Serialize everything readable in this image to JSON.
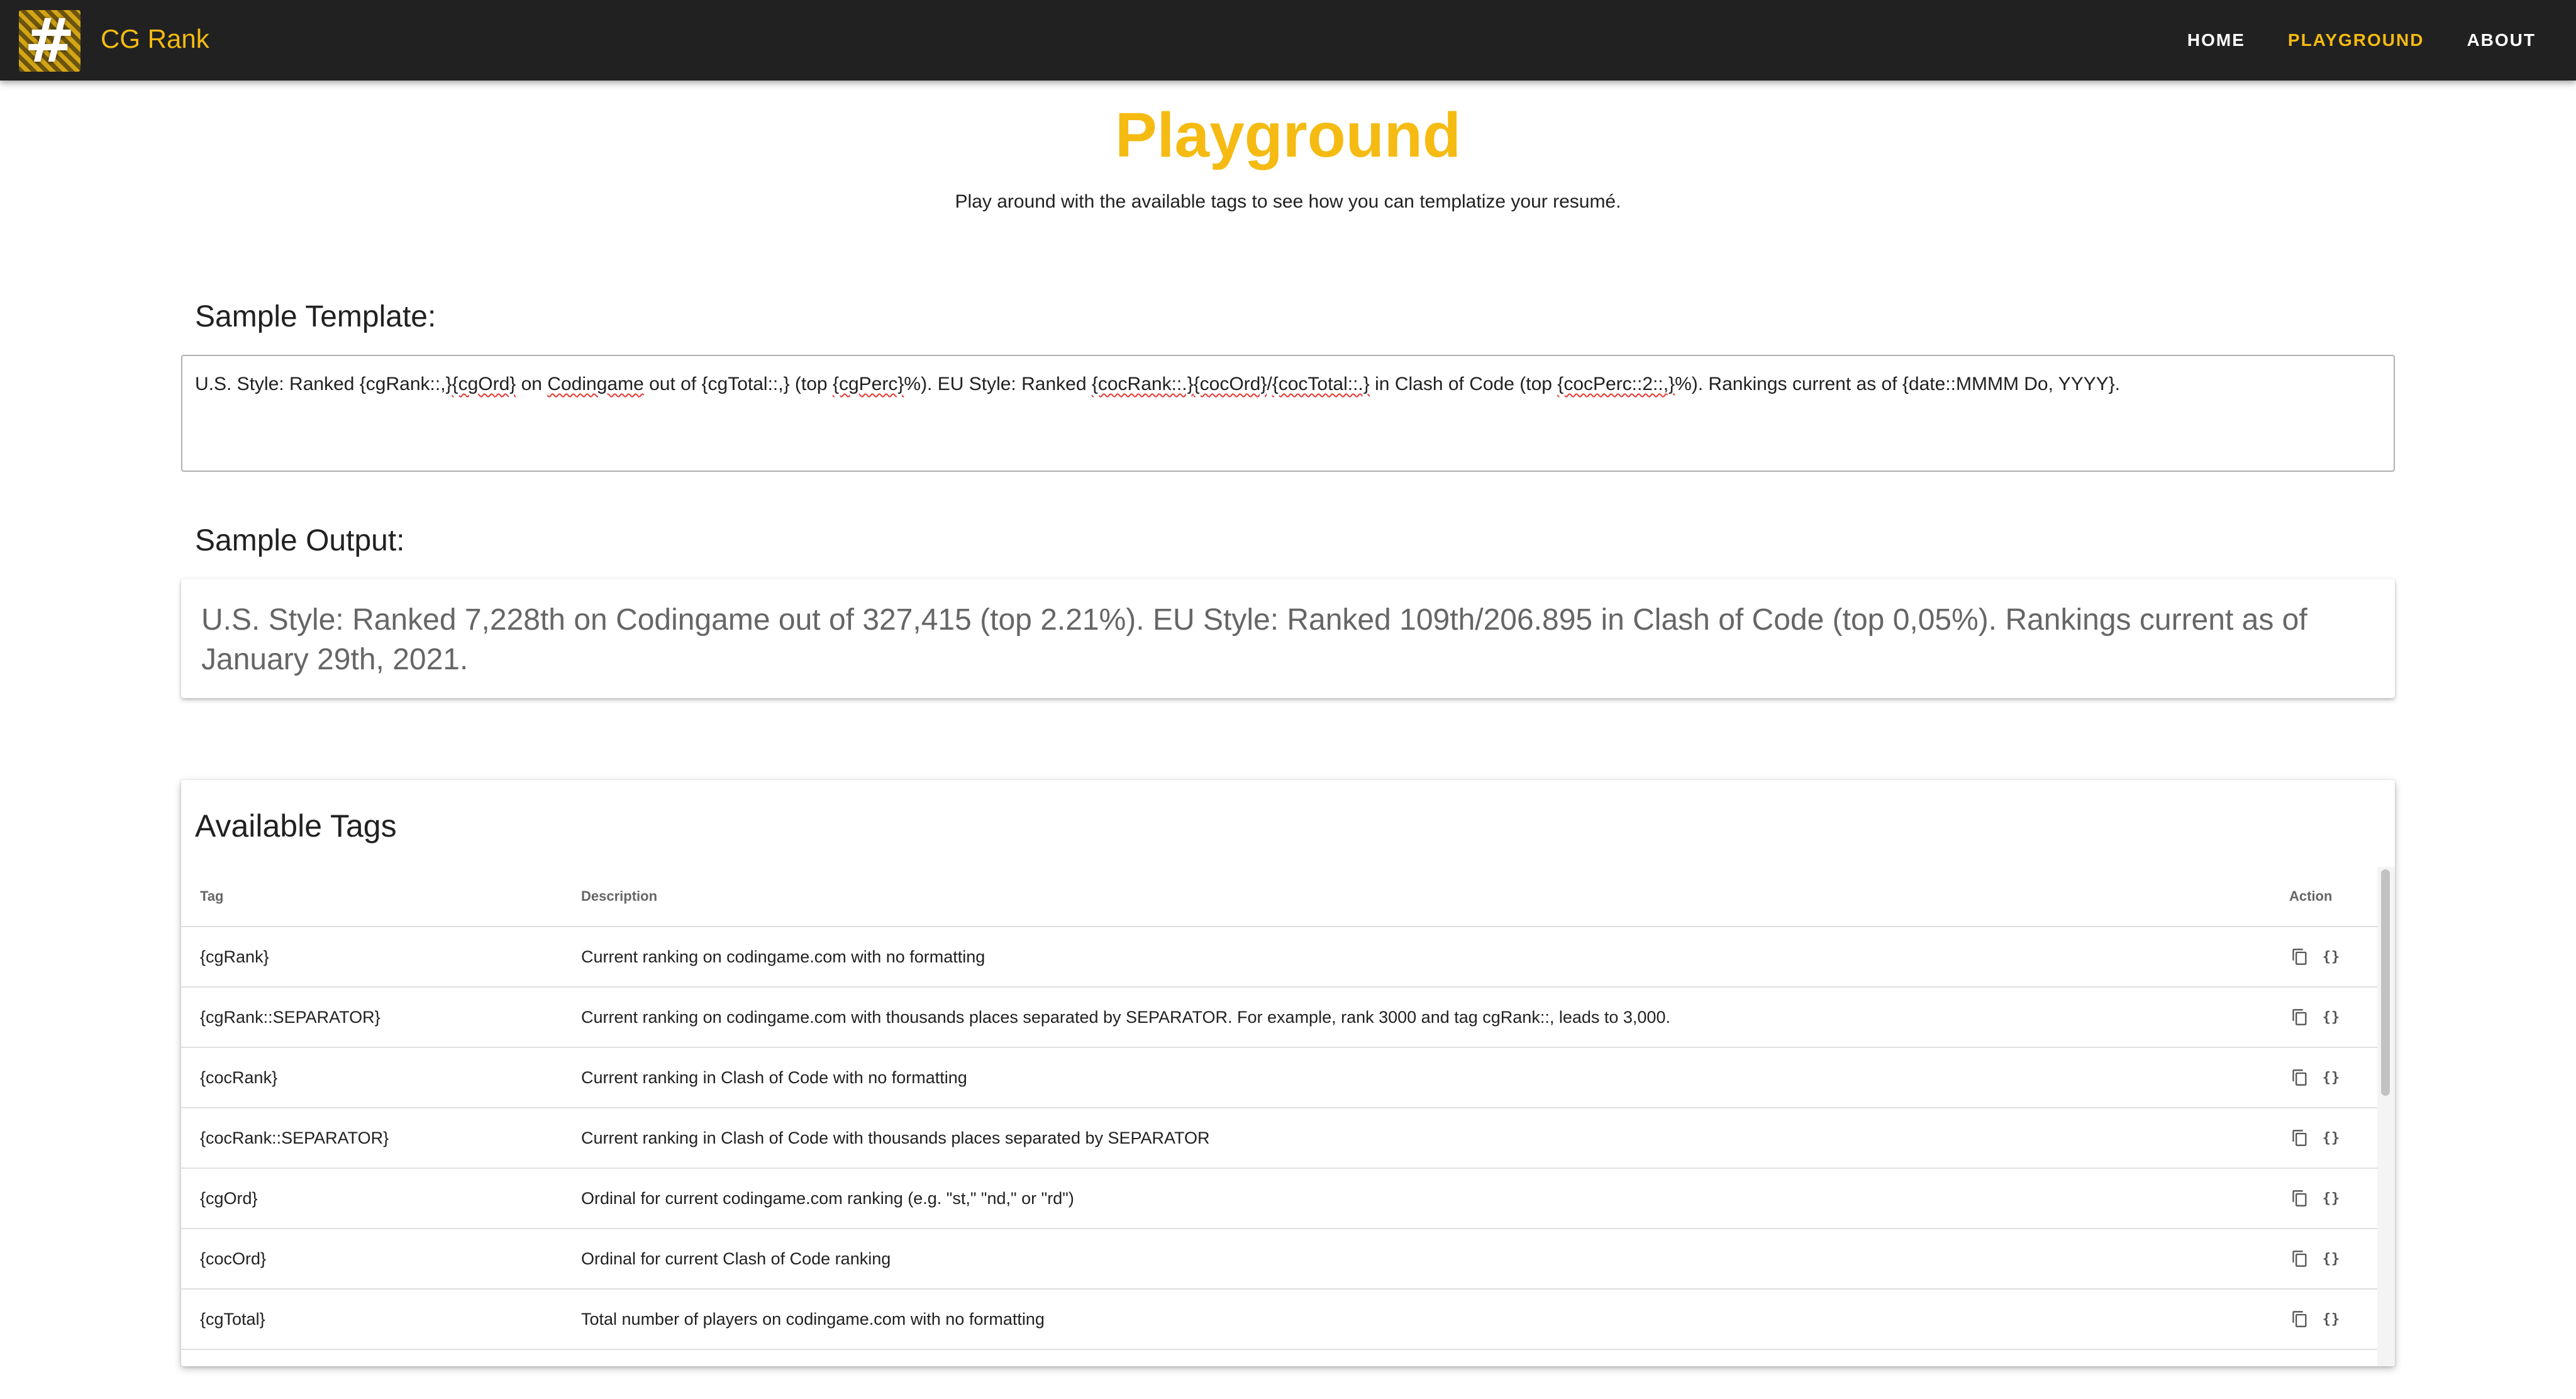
{
  "app": {
    "brand": "CG Rank",
    "logo_glyph": "#"
  },
  "nav": {
    "items": [
      {
        "label": "HOME",
        "active": false
      },
      {
        "label": "PLAYGROUND",
        "active": true
      },
      {
        "label": "ABOUT",
        "active": false
      }
    ]
  },
  "page": {
    "title": "Playground",
    "subtitle": "Play around with the available tags to see how you can templatize your resumé."
  },
  "template": {
    "heading": "Sample Template:",
    "parts": [
      {
        "text": "U.S. Style: Ranked {cgRank::,}",
        "spell": false
      },
      {
        "text": "{cgOrd}",
        "spell": true
      },
      {
        "text": " on ",
        "spell": false
      },
      {
        "text": "Codingame",
        "spell": true
      },
      {
        "text": " out of {cgTotal::,} (top ",
        "spell": false
      },
      {
        "text": "{cgPerc}",
        "spell": true
      },
      {
        "text": "%). EU Style: Ranked ",
        "spell": false
      },
      {
        "text": "{cocRank::.}",
        "spell": true
      },
      {
        "text": "{cocOrd}",
        "spell": true
      },
      {
        "text": "/",
        "spell": false
      },
      {
        "text": "{cocTotal::.}",
        "spell": true
      },
      {
        "text": " in Clash of Code (top ",
        "spell": false
      },
      {
        "text": "{cocPerc::2::,}",
        "spell": true
      },
      {
        "text": "%). Rankings current as of {date::MMMM Do, YYYY}.",
        "spell": false
      }
    ]
  },
  "output": {
    "heading": "Sample Output:",
    "text": "U.S. Style: Ranked 7,228th on Codingame out of 327,415 (top 2.21%). EU Style: Ranked 109th/206.895 in Clash of Code (top 0,05%). Rankings current as of January 29th, 2021."
  },
  "tags": {
    "title": "Available Tags",
    "columns": {
      "tag": "Tag",
      "description": "Description",
      "action": "Action"
    },
    "rows": [
      {
        "tag": "{cgRank}",
        "description": "Current ranking on codingame.com with no formatting"
      },
      {
        "tag": "{cgRank::SEPARATOR}",
        "description": "Current ranking on codingame.com with thousands places separated by SEPARATOR. For example, rank 3000 and tag cgRank::, leads to 3,000."
      },
      {
        "tag": "{cocRank}",
        "description": "Current ranking in Clash of Code with no formatting"
      },
      {
        "tag": "{cocRank::SEPARATOR}",
        "description": "Current ranking in Clash of Code with thousands places separated by SEPARATOR"
      },
      {
        "tag": "{cgOrd}",
        "description": "Ordinal for current codingame.com ranking (e.g. \"st,\" \"nd,\" or \"rd\")"
      },
      {
        "tag": "{cocOrd}",
        "description": "Ordinal for current Clash of Code ranking"
      },
      {
        "tag": "{cgTotal}",
        "description": "Total number of players on codingame.com with no formatting"
      },
      {
        "tag": "",
        "description": ""
      }
    ],
    "action_icons": [
      "copy-icon",
      "insert-braces-icon"
    ],
    "braces_glyph": "{}"
  }
}
